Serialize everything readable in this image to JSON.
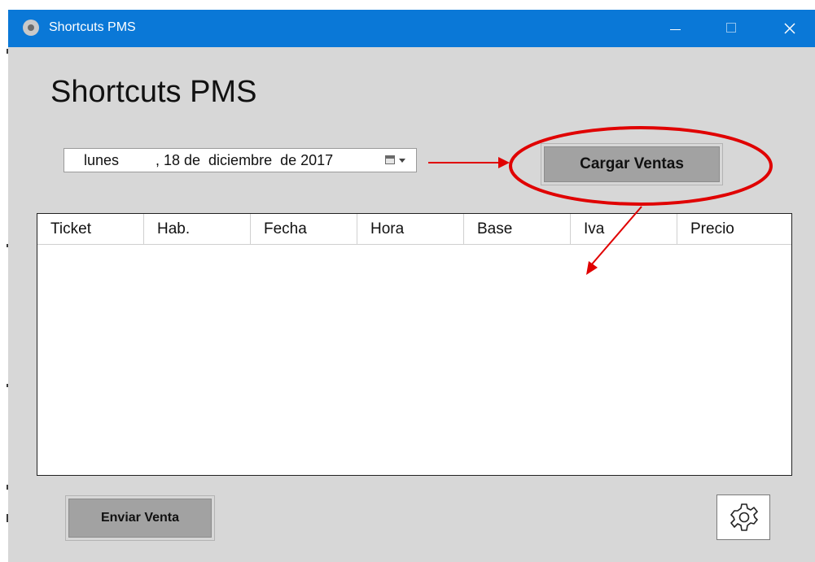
{
  "window": {
    "title": "Shortcuts PMS",
    "minimize_icon": "minimize-icon",
    "maximize_icon": "maximize-icon",
    "close_icon": "close-icon"
  },
  "main": {
    "heading": "Shortcuts PMS",
    "date_picker": {
      "day_name": "lunes",
      "date_rest": ", 18 de  diciembre  de 2017",
      "calendar_icon": "calendar-dropdown-icon"
    },
    "load_button_label": "Cargar Ventas",
    "grid": {
      "columns": [
        "Ticket",
        "Hab.",
        "Fecha",
        "Hora",
        "Base",
        "Iva",
        "Precio"
      ],
      "rows": []
    },
    "send_button_label": "Enviar Venta",
    "settings_icon": "gear-icon"
  },
  "annotations": {
    "color": "#e00000",
    "marks": [
      "arrow-to-button",
      "circle-around-button",
      "arrow-to-grid"
    ]
  }
}
